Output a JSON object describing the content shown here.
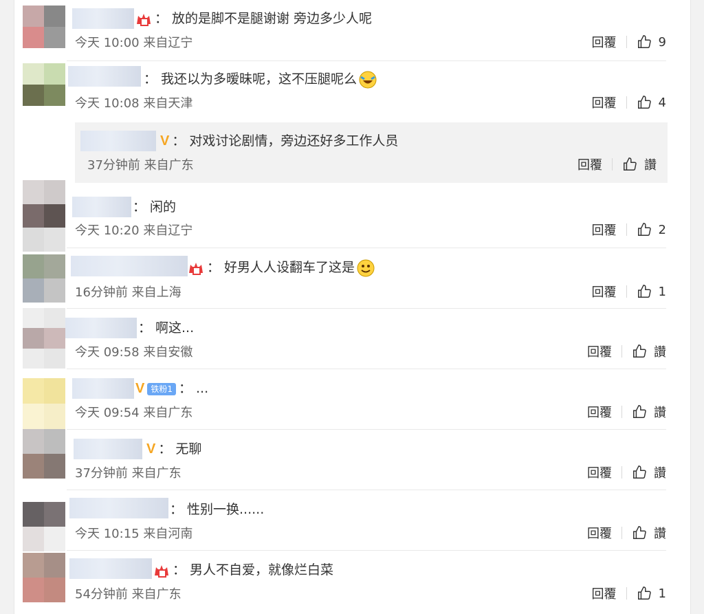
{
  "reply_label": "回覆",
  "like_zero_label": "讚",
  "comments": [
    {
      "text": "放的是脚不是腿谢谢 旁边多少人呢",
      "time": "今天 10:00",
      "location": "来自辽宁",
      "likes": "9"
    },
    {
      "text": "我还以为多暧昧呢，这不压腿呢么",
      "time": "今天 10:08",
      "location": "来自天津",
      "likes": "4"
    },
    {
      "text": "对戏讨论剧情，旁边还好多工作人员",
      "time": "37分钟前",
      "location": "来自广东",
      "likes": ""
    },
    {
      "text": "闲的",
      "time": "今天 10:20",
      "location": "来自辽宁",
      "likes": "2"
    },
    {
      "text": "好男人人设翻车了这是",
      "time": "16分钟前",
      "location": "来自上海",
      "likes": "1"
    },
    {
      "text": "啊这...",
      "time": "今天 09:58",
      "location": "来自安徽",
      "likes": ""
    },
    {
      "text": "...",
      "time": "今天 09:54",
      "location": "来自广东",
      "likes": "",
      "fan_badge": "铁粉1"
    },
    {
      "text": "无聊",
      "time": "37分钟前",
      "location": "来自广东",
      "likes": ""
    },
    {
      "text": "性别一换......",
      "time": "今天 10:15",
      "location": "来自河南",
      "likes": ""
    },
    {
      "text": "男人不自爱，就像烂白菜",
      "time": "54分钟前",
      "location": "来自广东",
      "likes": "1"
    }
  ]
}
